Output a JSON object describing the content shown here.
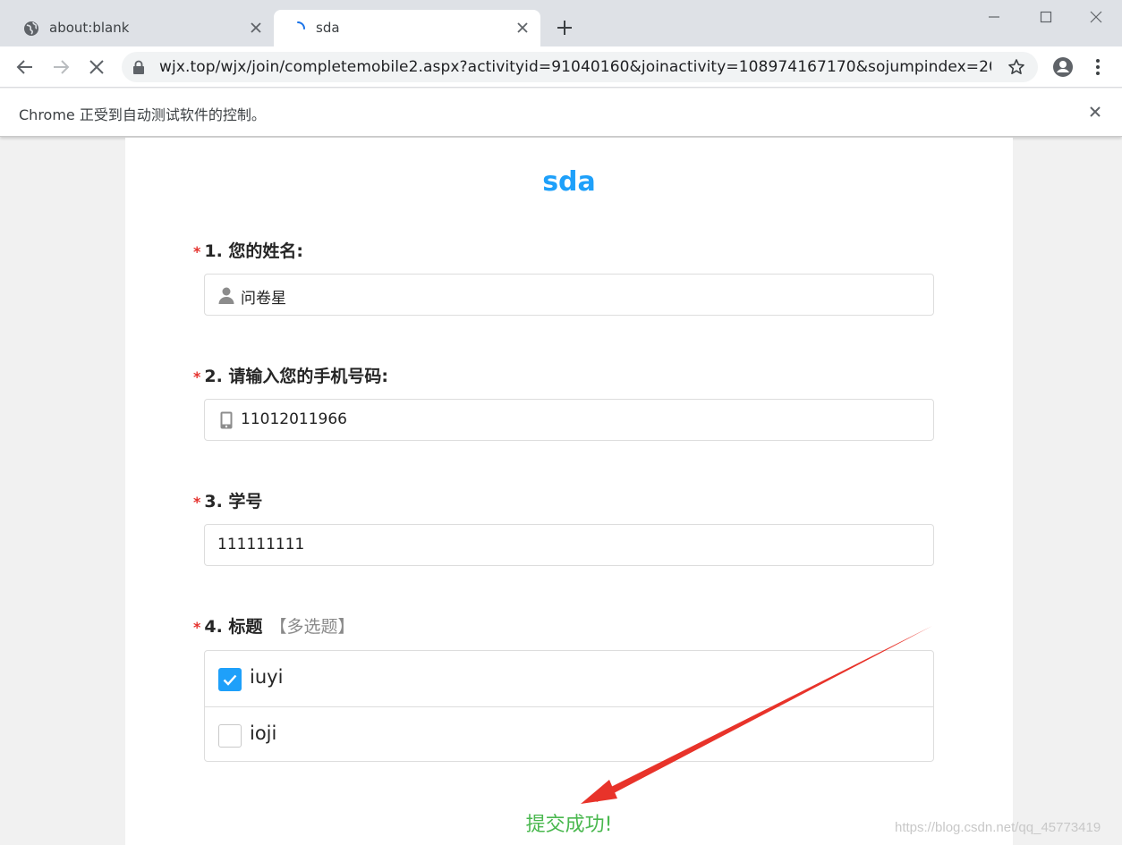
{
  "browser": {
    "tabs": [
      {
        "title": "about:blank",
        "icon": "globe-icon"
      },
      {
        "title": "sda",
        "icon": "loading-spinner-icon"
      }
    ],
    "url": "wjx.top/wjx/join/completemobile2.aspx?activityid=91040160&joinactivity=108974167170&sojumpindex=20&...",
    "infobar_message": "Chrome 正受到自动测试软件的控制。"
  },
  "survey": {
    "title": "sda",
    "required_mark": "*",
    "questions": [
      {
        "label": "1. 您的姓名:",
        "value": "问卷星",
        "icon": "person-icon"
      },
      {
        "label": "2. 请输入您的手机号码:",
        "value": "11012011966",
        "icon": "phone-icon"
      },
      {
        "label": "3. 学号",
        "value": "111111111"
      },
      {
        "label": "4. 标题",
        "tag": "【多选题】",
        "options": [
          {
            "label": "iuyi",
            "checked": true
          },
          {
            "label": "ioji",
            "checked": false
          }
        ]
      }
    ],
    "success_message": "提交成功!"
  },
  "annotation": {
    "arrow_color": "#e8332a"
  },
  "watermark": "https://blog.csdn.net/qq_45773419",
  "colors": {
    "accent": "#1ea0fa",
    "success": "#4ab84f",
    "required": "#e5322d"
  }
}
